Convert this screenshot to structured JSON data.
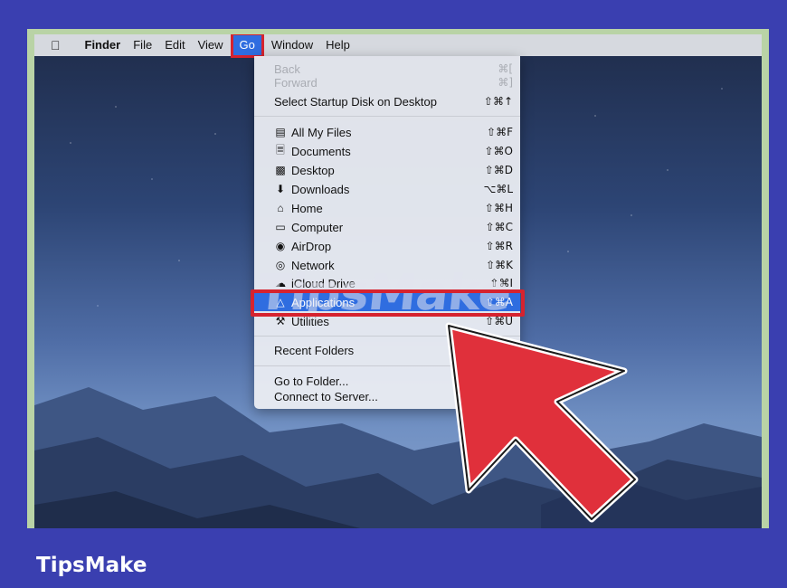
{
  "menubar": {
    "items": [
      "Finder",
      "File",
      "Edit",
      "View",
      "Go",
      "Window",
      "Help"
    ]
  },
  "go_menu": {
    "items": [
      {
        "label": "Back",
        "shortcut": "⌘[",
        "disabled": true
      },
      {
        "label": "Forward",
        "shortcut": "⌘]",
        "disabled": true
      },
      {
        "label": "Select Startup Disk on Desktop",
        "shortcut": "⇧⌘↑"
      },
      {
        "label": "All My Files",
        "shortcut": "⇧⌘F",
        "icon": "all-my-files-icon"
      },
      {
        "label": "Documents",
        "shortcut": "⇧⌘O",
        "icon": "documents-icon"
      },
      {
        "label": "Desktop",
        "shortcut": "⇧⌘D",
        "icon": "desktop-icon"
      },
      {
        "label": "Downloads",
        "shortcut": "⌥⌘L",
        "icon": "downloads-icon"
      },
      {
        "label": "Home",
        "shortcut": "⇧⌘H",
        "icon": "home-icon"
      },
      {
        "label": "Computer",
        "shortcut": "⇧⌘C",
        "icon": "computer-icon"
      },
      {
        "label": "AirDrop",
        "shortcut": "⇧⌘R",
        "icon": "airdrop-icon"
      },
      {
        "label": "Network",
        "shortcut": "⇧⌘K",
        "icon": "network-icon"
      },
      {
        "label": "iCloud Drive",
        "shortcut": "⇧⌘I",
        "icon": "icloud-icon"
      },
      {
        "label": "Applications",
        "shortcut": "⇧⌘A",
        "icon": "applications-icon",
        "selected": true
      },
      {
        "label": "Utilities",
        "shortcut": "⇧⌘U",
        "icon": "utilities-icon"
      },
      {
        "label": "Recent Folders"
      },
      {
        "label": "Go to Folder..."
      },
      {
        "label": "Connect to Server..."
      }
    ]
  },
  "watermark": "TipsMake",
  "brand": "TipsMake",
  "colors": {
    "highlight": "#d6232f",
    "selection": "#2f6de0",
    "page_background": "#3a3fb0"
  }
}
